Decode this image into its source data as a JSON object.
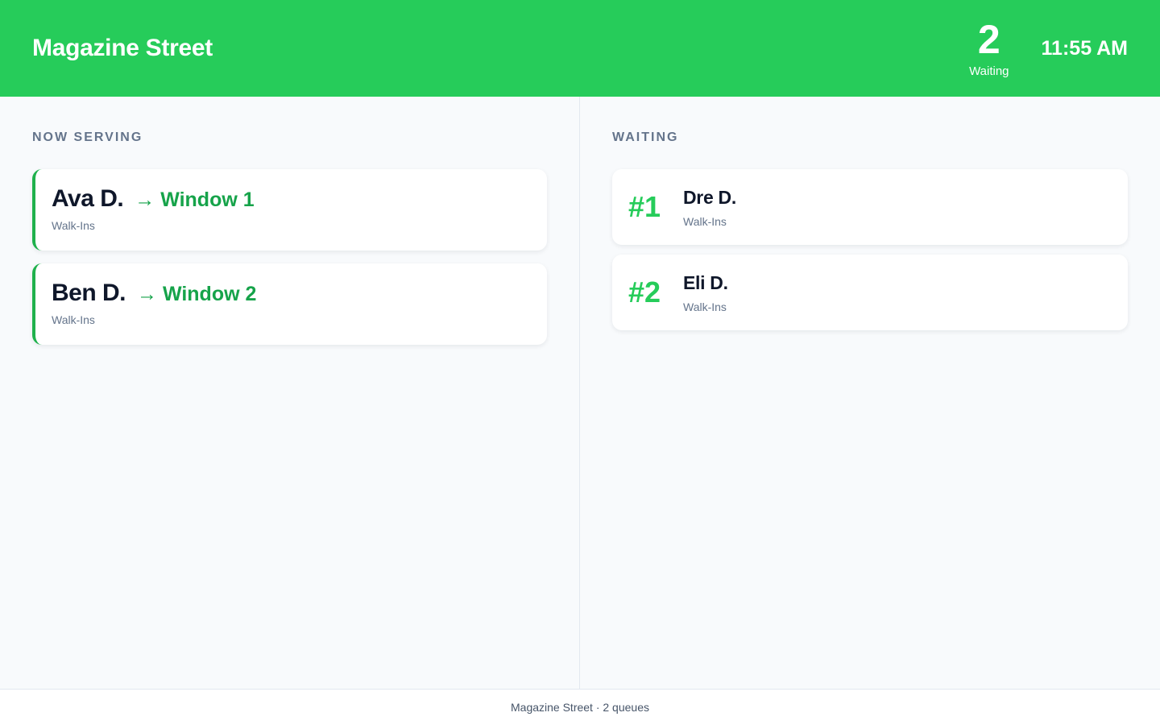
{
  "header": {
    "title": "Magazine Street",
    "waiting_count": "2",
    "waiting_label": "Waiting",
    "time": "11:55 AM",
    "accent_color": "#26cc5a"
  },
  "now_serving": {
    "heading": "NOW SERVING",
    "items": [
      {
        "name": "Ava D.",
        "window": "→ Window 1",
        "queue": "Walk-Ins"
      },
      {
        "name": "Ben D.",
        "window": "→ Window 2",
        "queue": "Walk-Ins"
      }
    ]
  },
  "waiting": {
    "heading": "WAITING",
    "items": [
      {
        "number": "#1",
        "name": "Dre D.",
        "queue": "Walk-Ins"
      },
      {
        "number": "#2",
        "name": "Eli D.",
        "queue": "Walk-Ins"
      }
    ]
  },
  "footer": {
    "text": "Magazine Street · 2 queues"
  }
}
